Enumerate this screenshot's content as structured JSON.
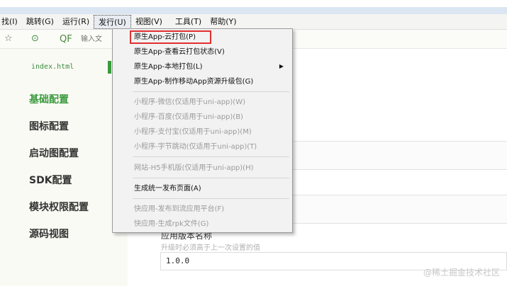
{
  "menubar": {
    "items": [
      {
        "label": "找(I)"
      },
      {
        "label": "跳转(G)"
      },
      {
        "label": "运行(R)"
      },
      {
        "label": "发行(U)"
      },
      {
        "label": "视图(V)"
      },
      {
        "label": "工具(T)"
      },
      {
        "label": "帮助(Y)"
      }
    ]
  },
  "toolbar": {
    "search_icon": "QF",
    "search_placeholder": "输入文"
  },
  "left_panel": {
    "file_tab": "index.html",
    "nav": [
      {
        "label": "基础配置"
      },
      {
        "label": "图标配置"
      },
      {
        "label": "启动图配置"
      },
      {
        "label": "SDK配置"
      },
      {
        "label": "模块权限配置"
      },
      {
        "label": "源码视图"
      }
    ]
  },
  "content": {
    "field_label": "应用版本名称",
    "field_hint": "升级时必须高于上一次设置的值",
    "field_value": "1.0.0",
    "watermark": "@稀土掘金技术社区"
  },
  "dropdown": {
    "items": [
      {
        "label": "原生App-云打包(P)"
      },
      {
        "label": "原生App-查看云打包状态(V)"
      },
      {
        "label": "原生App-本地打包(L)"
      },
      {
        "label": "原生App-制作移动App资源升级包(G)"
      },
      {
        "label": "小程序-微信(仅适用于uni-app)(W)"
      },
      {
        "label": "小程序-百度(仅适用于uni-app)(B)"
      },
      {
        "label": "小程序-支付宝(仅适用于uni-app)(M)"
      },
      {
        "label": "小程序-字节跳动(仅适用于uni-app)(T)"
      },
      {
        "label": "网站-H5手机版(仅适用于uni-app)(H)"
      },
      {
        "label": "生成统一发布页面(A)"
      },
      {
        "label": "快应用-发布到流应用平台(F)"
      },
      {
        "label": "快应用-生成rpk文件(G)"
      }
    ]
  }
}
